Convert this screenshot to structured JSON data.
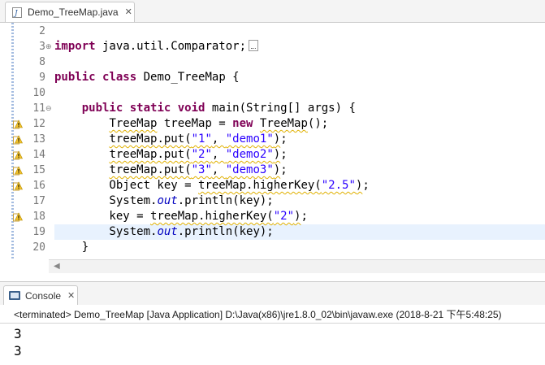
{
  "editor_tab": {
    "title": "Demo_TreeMap.java",
    "close": "✕"
  },
  "lines": [
    {
      "num": "2",
      "tokens": []
    },
    {
      "num": "3",
      "tokens": [
        {
          "t": "import",
          "c": "kw"
        },
        {
          "t": " java.util.Comparator;"
        }
      ],
      "fold": "⊕",
      "collapsed": true
    },
    {
      "num": "8",
      "tokens": []
    },
    {
      "num": "9",
      "tokens": [
        {
          "t": "public",
          "c": "kw"
        },
        {
          "t": " "
        },
        {
          "t": "class",
          "c": "kw"
        },
        {
          "t": " Demo_TreeMap {"
        }
      ]
    },
    {
      "num": "10",
      "tokens": []
    },
    {
      "num": "11",
      "tokens": [
        {
          "t": "    "
        },
        {
          "t": "public",
          "c": "kw"
        },
        {
          "t": " "
        },
        {
          "t": "static",
          "c": "kw"
        },
        {
          "t": " "
        },
        {
          "t": "void",
          "c": "kw"
        },
        {
          "t": " main(String[] args) {"
        }
      ],
      "fold": "⊖"
    },
    {
      "num": "12",
      "marker": true,
      "tokens": [
        {
          "t": "        "
        },
        {
          "t": "TreeMap",
          "w": 1
        },
        {
          "t": " treeMap = "
        },
        {
          "t": "new",
          "c": "kw"
        },
        {
          "t": " "
        },
        {
          "t": "TreeMap",
          "w": 1
        },
        {
          "t": "();"
        }
      ]
    },
    {
      "num": "13",
      "marker": true,
      "tokens": [
        {
          "t": "        "
        },
        {
          "t": "treeMap.put(",
          "w": 1
        },
        {
          "t": "\"1\"",
          "c": "str",
          "w": 1
        },
        {
          "t": ", ",
          "w": 1
        },
        {
          "t": "\"demo1\"",
          "c": "str",
          "w": 1
        },
        {
          "t": ")",
          "w": 1
        },
        {
          "t": ";"
        }
      ]
    },
    {
      "num": "14",
      "marker": true,
      "tokens": [
        {
          "t": "        "
        },
        {
          "t": "treeMap.put(",
          "w": 1
        },
        {
          "t": "\"2\"",
          "c": "str",
          "w": 1
        },
        {
          "t": ", ",
          "w": 1
        },
        {
          "t": "\"demo2\"",
          "c": "str",
          "w": 1
        },
        {
          "t": ")",
          "w": 1
        },
        {
          "t": ";"
        }
      ]
    },
    {
      "num": "15",
      "marker": true,
      "tokens": [
        {
          "t": "        "
        },
        {
          "t": "treeMap.put(",
          "w": 1
        },
        {
          "t": "\"3\"",
          "c": "str",
          "w": 1
        },
        {
          "t": ", ",
          "w": 1
        },
        {
          "t": "\"demo3\"",
          "c": "str",
          "w": 1
        },
        {
          "t": ")",
          "w": 1
        },
        {
          "t": ";"
        }
      ]
    },
    {
      "num": "16",
      "marker": true,
      "tokens": [
        {
          "t": "        Object key = "
        },
        {
          "t": "treeMap.higherKey(",
          "w": 1
        },
        {
          "t": "\"2.5\"",
          "c": "str",
          "w": 1
        },
        {
          "t": ")",
          "w": 1
        },
        {
          "t": ";"
        }
      ]
    },
    {
      "num": "17",
      "tokens": [
        {
          "t": "        System."
        },
        {
          "t": "out",
          "c": "ital"
        },
        {
          "t": ".println(key);"
        }
      ]
    },
    {
      "num": "18",
      "marker": true,
      "tokens": [
        {
          "t": "        key = "
        },
        {
          "t": "treeMap.higherKey(",
          "w": 1
        },
        {
          "t": "\"2\"",
          "c": "str",
          "w": 1
        },
        {
          "t": ")",
          "w": 1
        },
        {
          "t": ";"
        }
      ]
    },
    {
      "num": "19",
      "current": true,
      "tokens": [
        {
          "t": "        System."
        },
        {
          "t": "out",
          "c": "ital"
        },
        {
          "t": ".println(key);"
        }
      ]
    },
    {
      "num": "20",
      "tokens": [
        {
          "t": "    }"
        }
      ]
    }
  ],
  "console": {
    "tab_label": "Console",
    "close": "✕",
    "title": "<terminated> Demo_TreeMap [Java Application] D:\\Java(x86)\\jre1.8.0_02\\bin\\javaw.exe (2018-8-21 下午5:48:25)",
    "output": [
      "3",
      "3"
    ]
  },
  "colors": {
    "keyword": "#7f0055",
    "string": "#2a00ff",
    "static_field": "#0000c0",
    "current_line": "#e8f2fe",
    "warning": "#e0b000"
  }
}
